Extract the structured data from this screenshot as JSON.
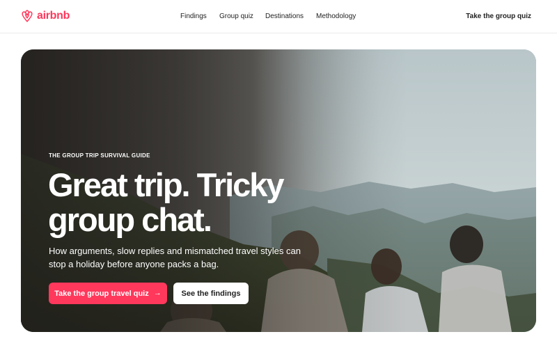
{
  "brand": {
    "name": "airbnb",
    "color": "#ff385c",
    "logo_icon": "airbnb-belo-icon"
  },
  "nav": {
    "links": [
      "Findings",
      "Group quiz",
      "Destinations",
      "Methodology"
    ],
    "cta_label": "Take the group quiz"
  },
  "hero": {
    "eyebrow": "THE GROUP TRIP SURVIVAL GUIDE",
    "headline_line1": "Great trip. Tricky",
    "headline_line2": "group chat.",
    "subtext": "How arguments, slow replies and mismatched travel styles can stop a holiday before anyone packs a bag.",
    "primary_button_label": "Take the group travel quiz",
    "primary_button_icon": "arrow-right-icon",
    "primary_button_icon_glyph": "→",
    "secondary_button_label": "See the findings",
    "image": "group-of-friends-overlooking-mountains-photo"
  }
}
